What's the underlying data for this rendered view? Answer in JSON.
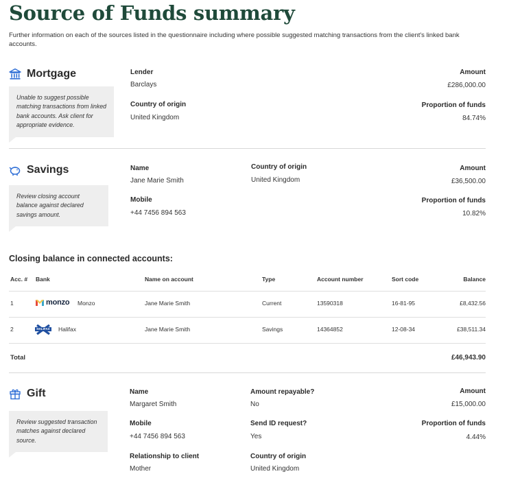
{
  "page": {
    "title": "Source of Funds summary",
    "intro": "Further information on each of the sources listed in the questionnaire including where possible suggested matching transactions from the client's linked bank accounts."
  },
  "mortgage": {
    "heading": "Mortgage",
    "icon": "bank-icon",
    "note": "Unable to suggest possible matching transactions from linked bank accounts. Ask client for appropriate evidence.",
    "lender_label": "Lender",
    "lender": "Barclays",
    "country_label": "Country of origin",
    "country": "United Kingdom",
    "amount_label": "Amount",
    "amount": "£286,000.00",
    "proportion_label": "Proportion of funds",
    "proportion": "84.74%"
  },
  "savings": {
    "heading": "Savings",
    "icon": "piggy-bank-icon",
    "note": "Review closing account balance against declared savings amount.",
    "name_label": "Name",
    "name": "Jane Marie Smith",
    "country_label": "Country of origin",
    "country": "United Kingdom",
    "mobile_label": "Mobile",
    "mobile": "+44 7456 894 563",
    "amount_label": "Amount",
    "amount": "£36,500.00",
    "proportion_label": "Proportion of funds",
    "proportion": "10.82%"
  },
  "accounts": {
    "heading": "Closing balance in connected accounts:",
    "columns": [
      "Acc. #",
      "Bank",
      "Name on account",
      "Type",
      "Account number",
      "Sort code",
      "Balance"
    ],
    "rows": [
      {
        "acc": "1",
        "logo_text": "monzo",
        "bank": "Monzo",
        "name": "Jane Marie Smith",
        "type": "Current",
        "number": "13590318",
        "sort": "16-81-95",
        "balance": "£8,432.56"
      },
      {
        "acc": "2",
        "logo_text": "HALIFAX",
        "bank": "Halifax",
        "name": "Jane Marie Smith",
        "type": "Savings",
        "number": "14364852",
        "sort": "12-08-34",
        "balance": "£38,511.34"
      }
    ],
    "total_label": "Total",
    "total": "£46,943.90"
  },
  "gift": {
    "heading": "Gift",
    "icon": "gift-icon",
    "note": "Review suggested transaction matches against declared source.",
    "name_label": "Name",
    "name": "Margaret Smith",
    "repayable_label": "Amount repayable?",
    "repayable": "No",
    "mobile_label": "Mobile",
    "mobile": "+44 7456 894 563",
    "send_id_label": "Send ID request?",
    "send_id": "Yes",
    "relationship_label": "Relationship to client",
    "relationship": "Mother",
    "country_label": "Country of origin",
    "country": "United Kingdom",
    "amount_label": "Amount",
    "amount": "£15,000.00",
    "proportion_label": "Proportion of funds",
    "proportion": "4.44%"
  },
  "colors": {
    "title": "#1f4a3a",
    "icon_blue": "#2f6fd6",
    "note_bg": "#eeeeee",
    "monzo_navy": "#14233c",
    "halifax_blue": "#1f4fa0"
  }
}
